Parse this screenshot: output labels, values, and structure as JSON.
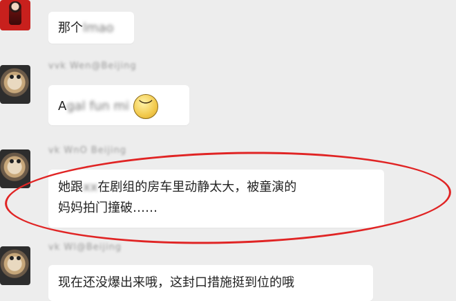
{
  "messages": [
    {
      "avatar": "red-character-avatar",
      "nickname": "",
      "text_visible": "那个",
      "text_redacted": "lmao"
    },
    {
      "avatar": "dog-avatar",
      "nickname": "vvk Wen@Beijing",
      "text_visible": "A",
      "text_redacted": "gal fun mi",
      "emoji": "worried-face-emoji"
    },
    {
      "avatar": "dog-avatar",
      "nickname": "vk WnO Beijing",
      "text_parts": [
        "她跟",
        "xx",
        "在剧组的房车里动静太大，被童演的",
        "妈妈拍门撞破……"
      ]
    },
    {
      "avatar": "dog-avatar",
      "nickname": "vk Wl@Beijing",
      "text": "现在还没爆出来哦，这封口措施挺到位的哦"
    }
  ],
  "annotation": {
    "type": "red-oval-highlight",
    "color": "#e02424"
  }
}
